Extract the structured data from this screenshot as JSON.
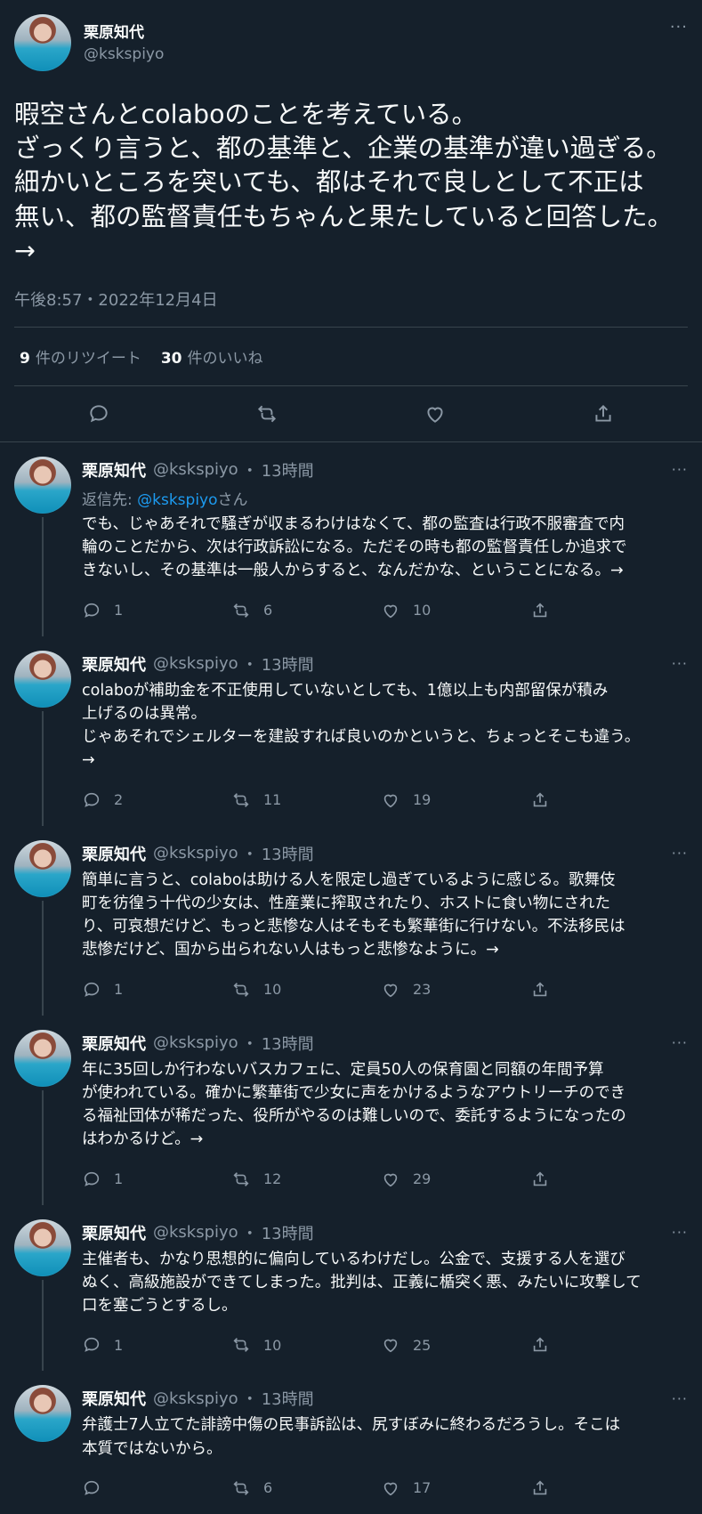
{
  "main_tweet": {
    "author_name": "栗原知代",
    "author_handle": "@kskspiyo",
    "more": "···",
    "text": "暇空さんとcolaboのことを考えている。\nざっくり言うと、都の基準と、企業の基準が違い過ぎる。\n細かいところを突いても、都はそれで良しとして不正は\n無い、都の監督責任もちゃんと果たしていると回答した。\n→",
    "timestamp": "午後8:57・2022年12月4日",
    "retweet_count": "9",
    "retweet_label": "件のリツイート",
    "like_count": "30",
    "like_label": "件のいいね"
  },
  "replies": [
    {
      "name": "栗原知代",
      "handle": "@kskspiyo",
      "dot": "・",
      "time": "13時間",
      "more": "···",
      "reply_prefix": "返信先: ",
      "reply_mention": "@kskspiyo",
      "reply_suffix": "さん",
      "text": "でも、じゃあそれで騒ぎが収まるわけはなくて、都の監査は行政不服審査で内\n輪のことだから、次は行政訴訟になる。ただその時も都の監督責任しか追求で\nきないし、その基準は一般人からすると、なんだかな、ということになる。→",
      "replies": "1",
      "retweets": "6",
      "likes": "10"
    },
    {
      "name": "栗原知代",
      "handle": "@kskspiyo",
      "dot": "・",
      "time": "13時間",
      "more": "···",
      "text": "colaboが補助金を不正使用していないとしても、1億以上も内部留保が積み\n上げるのは異常。\nじゃあそれでシェルターを建設すれば良いのかというと、ちょっとそこも違う。\n→",
      "replies": "2",
      "retweets": "11",
      "likes": "19"
    },
    {
      "name": "栗原知代",
      "handle": "@kskspiyo",
      "dot": "・",
      "time": "13時間",
      "more": "···",
      "text": "簡単に言うと、colaboは助ける人を限定し過ぎているように感じる。歌舞伎\n町を彷徨う十代の少女は、性産業に搾取されたり、ホストに食い物にされた\nり、可哀想だけど、もっと悲惨な人はそもそも繁華街に行けない。不法移民は\n悲惨だけど、国から出られない人はもっと悲惨なように。→",
      "replies": "1",
      "retweets": "10",
      "likes": "23"
    },
    {
      "name": "栗原知代",
      "handle": "@kskspiyo",
      "dot": "・",
      "time": "13時間",
      "more": "···",
      "text": "年に35回しか行わないバスカフェに、定員50人の保育園と同額の年間予算\nが使われている。確かに繁華街で少女に声をかけるようなアウトリーチのでき\nる福祉団体が稀だった、役所がやるのは難しいので、委託するようになったの\nはわかるけど。→",
      "replies": "1",
      "retweets": "12",
      "likes": "29"
    },
    {
      "name": "栗原知代",
      "handle": "@kskspiyo",
      "dot": "・",
      "time": "13時間",
      "more": "···",
      "text": "主催者も、かなり思想的に偏向しているわけだし。公金で、支援する人を選び\nぬく、高級施設ができてしまった。批判は、正義に楯突く悪、みたいに攻撃して\n口を塞ごうとするし。",
      "replies": "1",
      "retweets": "10",
      "likes": "25"
    },
    {
      "name": "栗原知代",
      "handle": "@kskspiyo",
      "dot": "・",
      "time": "13時間",
      "more": "···",
      "text": "弁護士7人立てた誹謗中傷の民事訴訟は、尻すぼみに終わるだろうし。そこは\n本質ではないから。",
      "replies": "",
      "retweets": "6",
      "likes": "17"
    }
  ],
  "colors": {
    "background": "#15202b",
    "text": "#f7f9f9",
    "muted": "#8b98a5",
    "accent": "#1d9bf0",
    "border": "#38444d"
  },
  "icons": [
    "reply-icon",
    "retweet-icon",
    "like-icon",
    "share-icon",
    "more-icon",
    "avatar"
  ]
}
